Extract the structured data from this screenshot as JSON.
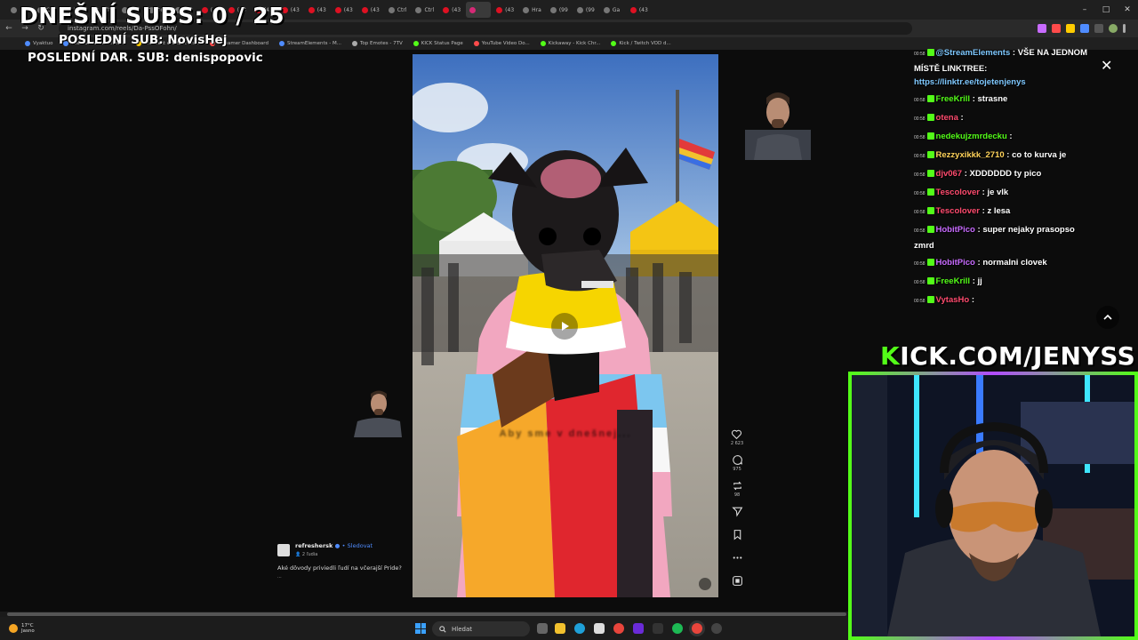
{
  "browser": {
    "tabs": [
      {
        "label": "",
        "icon": "overlay-tab"
      },
      {
        "label": "Ctrl",
        "icon": "tab"
      },
      {
        "label": "Kuu",
        "icon": "tab"
      },
      {
        "label": "w3V",
        "icon": "tab"
      },
      {
        "label": "mZ",
        "icon": "tab"
      },
      {
        "label": "pro",
        "icon": "tab"
      },
      {
        "label": "(99",
        "icon": "tab"
      },
      {
        "label": "(43",
        "icon": "youtube"
      },
      {
        "label": "(43",
        "icon": "youtube"
      },
      {
        "label": "(43",
        "icon": "youtube"
      },
      {
        "label": "(43",
        "icon": "youtube"
      },
      {
        "label": "(43",
        "icon": "youtube"
      },
      {
        "label": "(43",
        "icon": "youtube"
      },
      {
        "label": "(43",
        "icon": "youtube"
      },
      {
        "label": "Ctrl",
        "icon": "tab"
      },
      {
        "label": "Ctrl",
        "icon": "tab"
      },
      {
        "label": "(43",
        "icon": "youtube"
      },
      {
        "label": "",
        "icon": "instagram"
      },
      {
        "label": "(43",
        "icon": "youtube"
      },
      {
        "label": "Hra",
        "icon": "tab"
      },
      {
        "label": "(99",
        "icon": "tab"
      },
      {
        "label": "(99",
        "icon": "tab"
      },
      {
        "label": "Ga",
        "icon": "tab"
      },
      {
        "label": "(43",
        "icon": "youtube"
      }
    ],
    "url": "instagram.com/reels/Da-PssOFohn/",
    "bookmarks": [
      {
        "label": "Vyaktuo",
        "color": "#4f8cff"
      },
      {
        "label": "File Converter - Free...",
        "color": "#4f8cff"
      },
      {
        "label": "The best ChatBot an...",
        "color": "#ffcc00"
      },
      {
        "label": "Streamer Dashboard",
        "color": "#ff4b4b"
      },
      {
        "label": "StreamElements - M...",
        "color": "#4f8cff"
      },
      {
        "label": "Top Emotes - 7TV",
        "color": "#aaa"
      },
      {
        "label": "KICK Status Page",
        "color": "#53fc18"
      },
      {
        "label": "YouTube Video Do...",
        "color": "#ff4b4b"
      },
      {
        "label": "Kickaway - Kick Chr...",
        "color": "#53fc18"
      },
      {
        "label": "Kick / Twitch VOD d...",
        "color": "#53fc18"
      }
    ]
  },
  "overlay": {
    "subs_goal": "DNEŠNÍ SUBS: 0 / 25",
    "last_sub": "POSLEDNÍ SUB: NovisHej",
    "last_dar_sub": "POSLEDNÍ DAR. SUB: denispopovic",
    "kick_prefix": "K",
    "kick_rest": "ICK.COM/JENYSS"
  },
  "reel": {
    "caption": "Aby sme v dnešnej...",
    "likes": "2 623",
    "comments": "975",
    "reposts": "98",
    "username": "refreshersk",
    "follow": "Sledovat",
    "collab": "2 ľudia",
    "text": "Aké dôvody priviedli ľudí na včerajší Pride?",
    "more": "..."
  },
  "chat": {
    "messages": [
      {
        "time": "00:58",
        "user": "@StreamElements",
        "color": "#7ec8ff",
        "text": "VŠE NA JEDNOM MÍSTĚ LINKTREE: ",
        "link": "https://linktr.ee/tojetenjenys"
      },
      {
        "time": "00:58",
        "user": "FreeKrill",
        "color": "#53fc18",
        "text": "strasne"
      },
      {
        "time": "00:58",
        "user": "otena",
        "color": "#ff4b6e",
        "text": ""
      },
      {
        "time": "00:58",
        "user": "nedekujzmrdecku",
        "color": "#53fc18",
        "text": ""
      },
      {
        "time": "00:58",
        "user": "Rezzyxikkk_2710",
        "color": "#ffd35a",
        "text": "co to kurva je"
      },
      {
        "time": "00:58",
        "user": "djv067",
        "color": "#ff4b6e",
        "text": "XDDDDDD ty pico"
      },
      {
        "time": "00:58",
        "user": "Tescolover",
        "color": "#ff4b6e",
        "text": "je vlk"
      },
      {
        "time": "00:58",
        "user": "Tescolover",
        "color": "#ff4b6e",
        "text": "z lesa"
      },
      {
        "time": "00:58",
        "user": "HobitPico",
        "color": "#c86bff",
        "text": "super nejaky prasopso zmrd"
      },
      {
        "time": "00:58",
        "user": "HobitPico",
        "color": "#c86bff",
        "text": "normalni clovek"
      },
      {
        "time": "00:58",
        "user": "FreeKrill",
        "color": "#53fc18",
        "text": "jj"
      },
      {
        "time": "00:58",
        "user": "VytasHo",
        "color": "#ff4b6e",
        "text": ""
      }
    ]
  },
  "taskbar": {
    "temp": "17°C",
    "weather": "Jasno",
    "search_placeholder": "Hledat"
  }
}
